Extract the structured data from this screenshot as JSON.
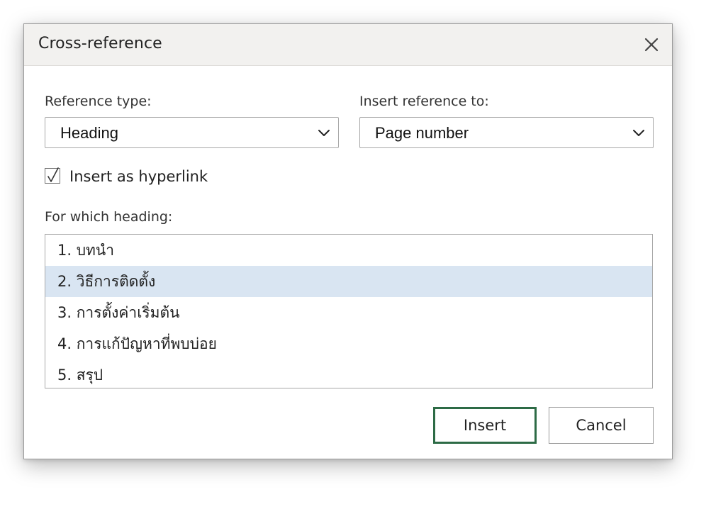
{
  "dialog": {
    "title": "Cross-reference",
    "close_icon": "close-icon"
  },
  "reference_type": {
    "label": "Reference type:",
    "value": "Heading",
    "icon": "chevron-down-icon"
  },
  "insert_reference_to": {
    "label": "Insert reference to:",
    "value": "Page number",
    "icon": "chevron-down-icon"
  },
  "insert_as_hyperlink": {
    "label": "Insert as hyperlink",
    "checked": true
  },
  "headings": {
    "label": "For which heading:",
    "items": [
      {
        "text": "1. บทนำ",
        "selected": false
      },
      {
        "text": "2. วิธีการติดตั้ง",
        "selected": true
      },
      {
        "text": "3. การตั้งค่าเริ่มต้น",
        "selected": false
      },
      {
        "text": "4. การแก้ปัญหาที่พบบ่อย",
        "selected": false
      },
      {
        "text": "5. สรุป",
        "selected": false
      }
    ]
  },
  "buttons": {
    "insert": "Insert",
    "cancel": "Cancel"
  },
  "colors": {
    "selection": "#d9e5f2",
    "primary_border": "#2d6b46",
    "titlebar": "#f2f1ef"
  }
}
